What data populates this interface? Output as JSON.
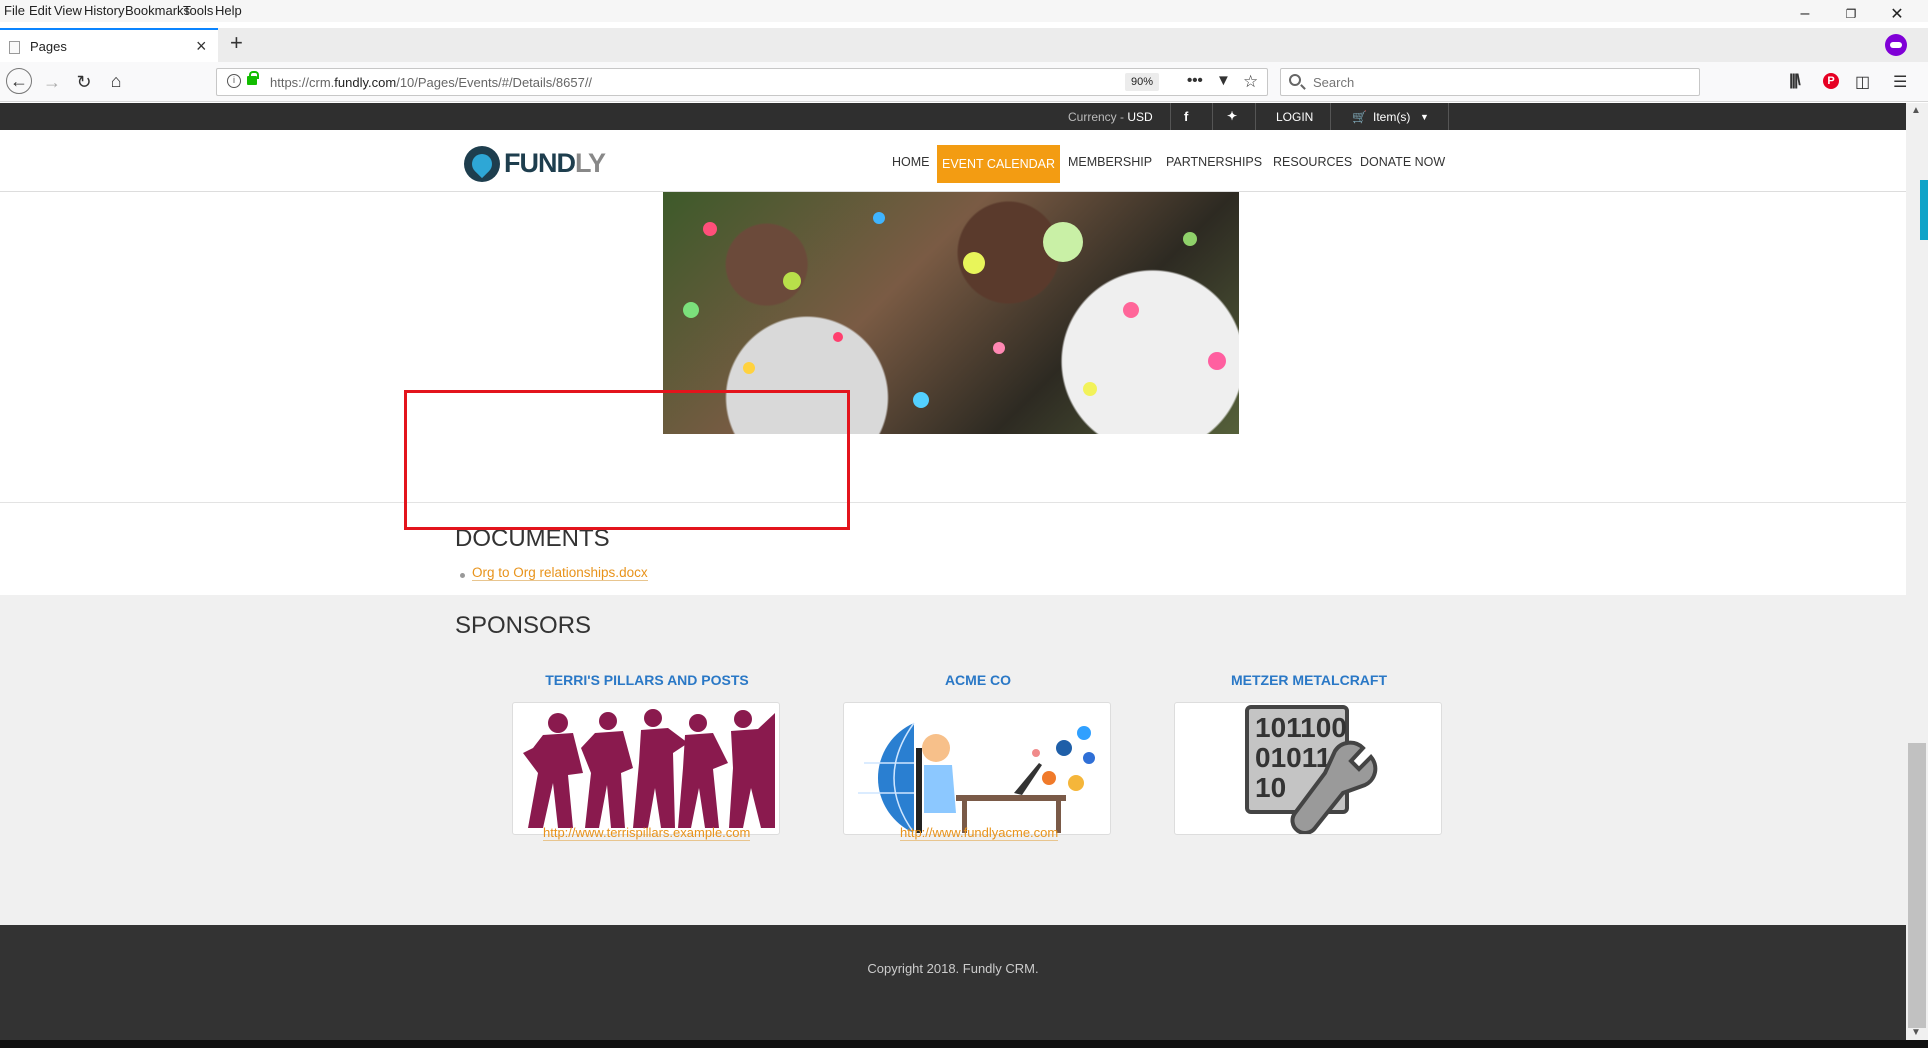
{
  "browser": {
    "menu": [
      "File",
      "Edit",
      "View",
      "History",
      "Bookmarks",
      "Tools",
      "Help"
    ],
    "tab_title": "Pages",
    "url_prefix": "https://crm.",
    "url_domain": "fundly.com",
    "url_path": "/10/Pages/Events/#/Details/8657//",
    "zoom": "90%",
    "search_placeholder": "Search"
  },
  "site": {
    "currency_label": "Currency - ",
    "currency_value": "USD",
    "login": "LOGIN",
    "cart": "Item(s)",
    "logo_main": "FUND",
    "logo_accent": "LY",
    "nav": {
      "home": "HOME",
      "event_calendar": "EVENT CALENDAR",
      "membership": "MEMBERSHIP",
      "partnerships": "PARTNERSHIPS",
      "resources": "RESOURCES",
      "donate": "DONATE NOW"
    }
  },
  "documents": {
    "title": "DOCUMENTS",
    "items": [
      "Org to Org relationships.docx"
    ]
  },
  "sponsors": {
    "title": "SPONSORS",
    "items": [
      {
        "name": "TERRI'S PILLARS AND POSTS",
        "url": "http://www.terrispillars.example.com"
      },
      {
        "name": "ACME CO",
        "url": "http://www.fundlyacme.com"
      },
      {
        "name": "METZER METALCRAFT",
        "url": ""
      }
    ],
    "binary_text": [
      "101100",
      "01011",
      "10"
    ]
  },
  "footer": {
    "copyright": "Copyright 2018. Fundly CRM."
  },
  "colors": {
    "accent_orange": "#f39c12",
    "link_orange": "#e8931b",
    "sponsor_blue": "#2a78c6",
    "highlight_red": "#e3141c",
    "topbar": "#2f2f2f",
    "footer": "#333333"
  }
}
